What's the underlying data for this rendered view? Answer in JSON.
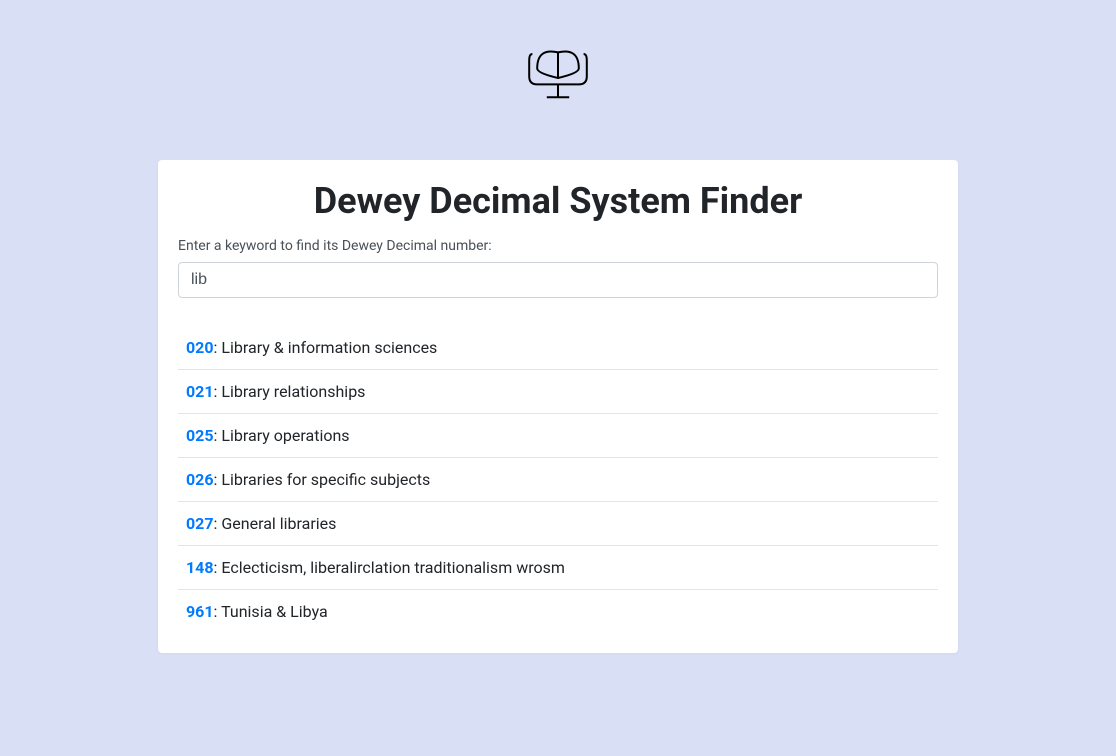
{
  "logo": {
    "name": "book-stand-icon"
  },
  "card": {
    "title": "Dewey Decimal System Finder",
    "input_label": "Enter a keyword to find its Dewey Decimal number:",
    "input_value": "lib"
  },
  "results": [
    {
      "number": "020",
      "text": "Library & information sciences"
    },
    {
      "number": "021",
      "text": "Library relationships"
    },
    {
      "number": "025",
      "text": "Library operations"
    },
    {
      "number": "026",
      "text": "Libraries for specific subjects"
    },
    {
      "number": "027",
      "text": "General libraries"
    },
    {
      "number": "148",
      "text": "Eclecticism, liberalirclation traditionalism wrosm"
    },
    {
      "number": "961",
      "text": "Tunisia & Libya"
    }
  ]
}
